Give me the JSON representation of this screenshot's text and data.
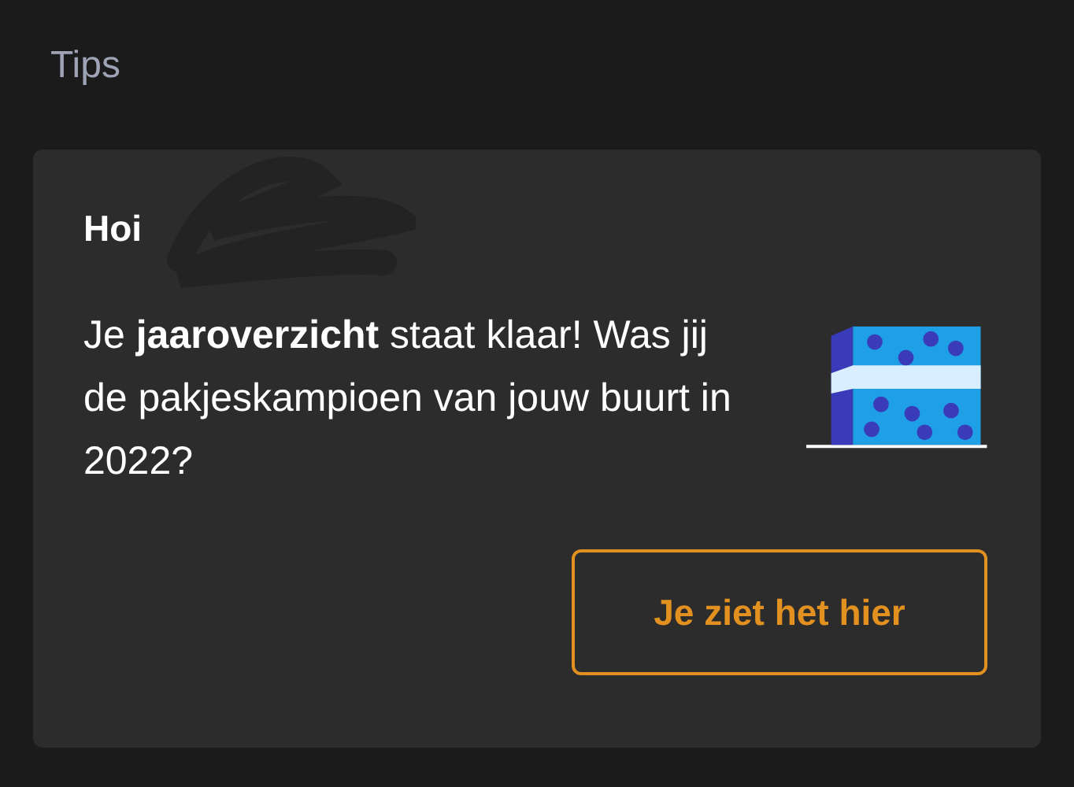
{
  "section_title": "Tips",
  "card": {
    "greeting": "Hoi",
    "message": "Je **jaaroverzicht** staat klaar! Was jij de pakjeskampioen van jouw buurt in 2022?",
    "button": "Je ziet het hier"
  }
}
